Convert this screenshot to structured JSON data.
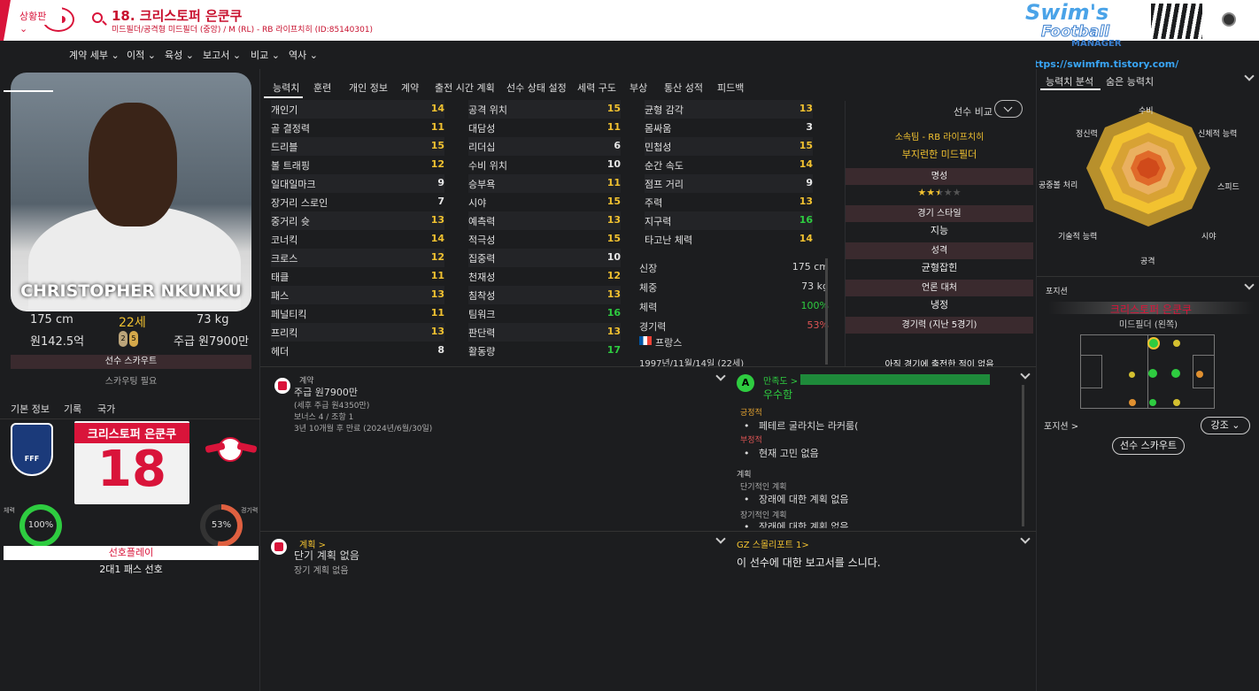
{
  "header": {
    "title": "18. 크리스토퍼 은쿤쿠",
    "subtitle": "미드필더/공격형 미드필더 (중앙) / M (RL) - RB 라이프치히 (ID:85140301)",
    "brand_line1": "Swim's",
    "brand_line2": "Football",
    "brand_line3": "MANAGER",
    "brand_url": "https://swimfm.tistory.com/"
  },
  "nav": {
    "active": "상황판",
    "items": [
      "계약 세부",
      "이적",
      "육성",
      "보고서",
      "비교",
      "역사"
    ]
  },
  "player": {
    "photo_name": "CHRISTOPHER NKUNKU",
    "height": "175 cm",
    "age": "22세",
    "weight": "73 kg",
    "value": "원142.5억",
    "wage": "주급 원7900만",
    "boot_left": "2",
    "boot_right": "5",
    "scout_label": "선수 스카우트",
    "scout_need": "스카우팅 필요",
    "jersey_name": "크리스토퍼 은쿤쿠",
    "jersey_number": "18",
    "fff_text": "FFF",
    "fitness_label": "체력",
    "fitness": "100%",
    "sharp_label": "경기력",
    "sharpness": "53%",
    "pref_label": "선호플레이",
    "pref_value": "2대1 패스 선호"
  },
  "left_tabs": [
    "기본 정보",
    "기록",
    "국가"
  ],
  "center_tabs": [
    "능력치",
    "훈련",
    "개인 정보",
    "계약",
    "출전 시간 계획",
    "선수 상태 설정",
    "세력 구도",
    "부상",
    "통산 성적",
    "피드백"
  ],
  "attributes": {
    "col1": [
      {
        "name": "개인기",
        "value": "14",
        "color": "#f2c230"
      },
      {
        "name": "골 결정력",
        "value": "11",
        "color": "#f2c230"
      },
      {
        "name": "드리블",
        "value": "15",
        "color": "#f2c230"
      },
      {
        "name": "볼 트래핑",
        "value": "12",
        "color": "#f2c230"
      },
      {
        "name": "일대일마크",
        "value": "9",
        "color": "#e8e8e8"
      },
      {
        "name": "장거리 스로인",
        "value": "7",
        "color": "#e8e8e8"
      },
      {
        "name": "중거리 슛",
        "value": "13",
        "color": "#f2c230"
      },
      {
        "name": "코너킥",
        "value": "14",
        "color": "#f2c230"
      },
      {
        "name": "크로스",
        "value": "12",
        "color": "#f2c230"
      },
      {
        "name": "태클",
        "value": "11",
        "color": "#f2c230"
      },
      {
        "name": "패스",
        "value": "13",
        "color": "#f2c230"
      },
      {
        "name": "페널티킥",
        "value": "11",
        "color": "#f2c230"
      },
      {
        "name": "프리킥",
        "value": "13",
        "color": "#f2c230"
      },
      {
        "name": "헤더",
        "value": "8",
        "color": "#e8e8e8"
      }
    ],
    "col2": [
      {
        "name": "공격 위치",
        "value": "15",
        "color": "#f2c230"
      },
      {
        "name": "대담성",
        "value": "11",
        "color": "#f2c230"
      },
      {
        "name": "리더십",
        "value": "6",
        "color": "#e8e8e8"
      },
      {
        "name": "수비 위치",
        "value": "10",
        "color": "#e8e8e8"
      },
      {
        "name": "승부욕",
        "value": "11",
        "color": "#f2c230"
      },
      {
        "name": "시야",
        "value": "15",
        "color": "#f2c230"
      },
      {
        "name": "예측력",
        "value": "13",
        "color": "#f2c230"
      },
      {
        "name": "적극성",
        "value": "15",
        "color": "#f2c230"
      },
      {
        "name": "집중력",
        "value": "10",
        "color": "#e8e8e8"
      },
      {
        "name": "천재성",
        "value": "12",
        "color": "#f2c230"
      },
      {
        "name": "침착성",
        "value": "13",
        "color": "#f2c230"
      },
      {
        "name": "팀워크",
        "value": "16",
        "color": "#2ecc40"
      },
      {
        "name": "판단력",
        "value": "13",
        "color": "#f2c230"
      },
      {
        "name": "활동량",
        "value": "17",
        "color": "#2ecc40"
      }
    ],
    "col3": [
      {
        "name": "균형 감각",
        "value": "13",
        "color": "#f2c230"
      },
      {
        "name": "몸싸움",
        "value": "3",
        "color": "#e8e8e8"
      },
      {
        "name": "민첩성",
        "value": "15",
        "color": "#f2c230"
      },
      {
        "name": "순간 속도",
        "value": "14",
        "color": "#f2c230"
      },
      {
        "name": "점프 거리",
        "value": "9",
        "color": "#e8e8e8"
      },
      {
        "name": "주력",
        "value": "13",
        "color": "#f2c230"
      },
      {
        "name": "지구력",
        "value": "16",
        "color": "#2ecc40"
      },
      {
        "name": "타고난 체력",
        "value": "14",
        "color": "#f2c230"
      }
    ]
  },
  "physical": [
    {
      "label": "신장",
      "value": "175 cm",
      "color": "#d8d8d8"
    },
    {
      "label": "체중",
      "value": "73 kg",
      "color": "#d8d8d8"
    },
    {
      "label": "체력",
      "value": "100%",
      "color": "#2ecc40"
    },
    {
      "label": "경기력",
      "value": "53%",
      "color": "#e05555"
    }
  ],
  "nationality": "프랑스",
  "birth": "1997년/11월/14일 (22세)",
  "info": {
    "compare": "선수 비교",
    "club_line": "소속팀 - RB 라이프치히",
    "role": "부지런한 미드필더",
    "rep_head": "명성",
    "rep_stars": "★★★★★",
    "style_head": "경기 스타일",
    "style_val": "지능",
    "pers_head": "성격",
    "pers_val": "균형잡힌",
    "media_head": "언론 대처",
    "media_val": "냉정",
    "form_head": "경기력 (지난 5경기)",
    "form_val": "아직 경기에 출전한 적이 없음"
  },
  "contract": {
    "head": "계약",
    "wage": "주급 원7900만",
    "after_tax": "(세후 주급 원4350만)",
    "bonus": "보너스 4 / 조항 1",
    "expiry": "3년 10개월 후 만료 (2024년/6월/30일)"
  },
  "satisfaction": {
    "head": "만족도 >",
    "value": "우수함",
    "pos_head": "긍정적",
    "pos_item": "페테르 굴라치는 라커룸(",
    "neg_head": "부정적",
    "neg_item": "현재 고민 없음",
    "plan_head": "계획",
    "short_head": "단기적인 계획",
    "short_item": "장래에 대한 계획 없음",
    "long_head": "장기적인 계획",
    "long_item": "장래에 대한 계획 없음"
  },
  "plans": {
    "head": "계획 >",
    "short": "단기 계획 없음",
    "long": "장기 계획 없음"
  },
  "gz": {
    "head": "GZ 스몰리포트 1>",
    "text": "이 선수에 대한 보고서를 스니다."
  },
  "right": {
    "tab1": "능력치 분석",
    "tab2": "숨은 능력치",
    "attr_labels": [
      "수비",
      "신체적 능력",
      "스피드",
      "시야",
      "공격",
      "기술적 능력",
      "공중볼 처리",
      "정신력"
    ],
    "pos_head": "포지션",
    "pos_name": "크리스토퍼 은쿤쿠",
    "pos_role": "미드필더 (왼쪽)",
    "pos_link": "포지션 >",
    "emph": "강조",
    "scout_btn": "선수 스카우트"
  }
}
